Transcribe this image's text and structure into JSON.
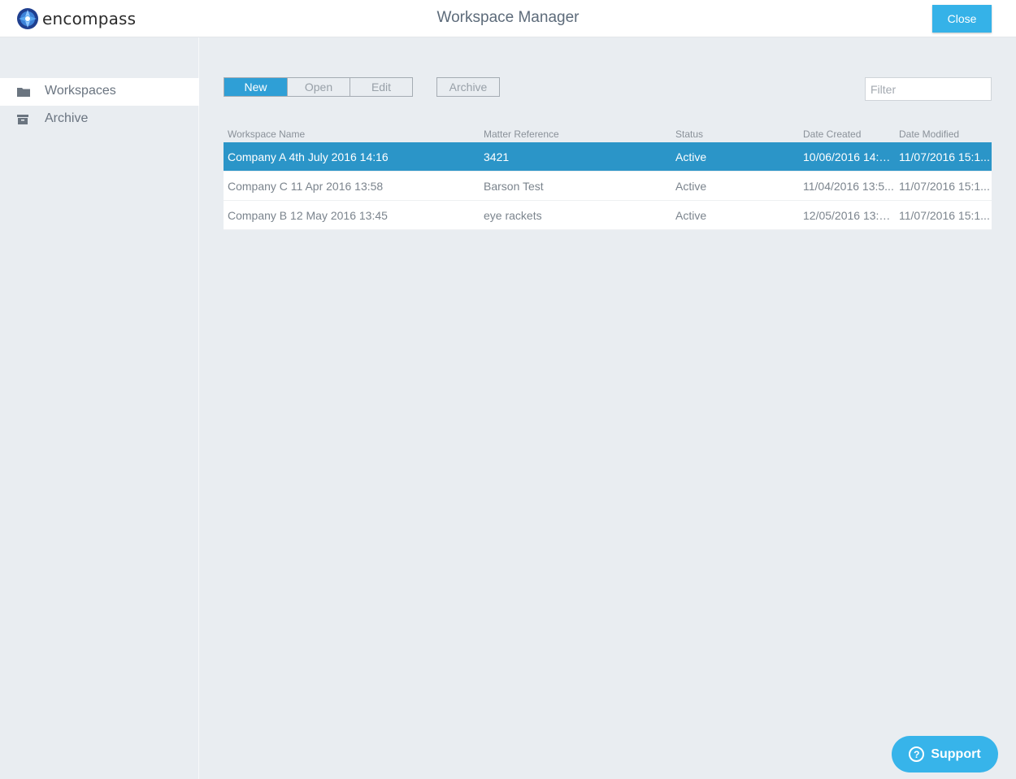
{
  "header": {
    "logo_text": "encompass",
    "title": "Workspace Manager",
    "close_label": "Close"
  },
  "sidebar": {
    "items": [
      {
        "label": "Workspaces",
        "icon": "folder-icon",
        "active": true
      },
      {
        "label": "Archive",
        "icon": "archive-box-icon",
        "active": false
      }
    ]
  },
  "toolbar": {
    "new_label": "New",
    "open_label": "Open",
    "edit_label": "Edit",
    "archive_label": "Archive",
    "filter_placeholder": "Filter"
  },
  "table": {
    "columns": [
      "Workspace Name",
      "Matter Reference",
      "Status",
      "Date Created",
      "Date Modified"
    ],
    "rows": [
      {
        "name": "Company A 4th July 2016 14:16",
        "matter": "3421",
        "status": "Active",
        "created": "10/06/2016 14:1...",
        "modified": "11/07/2016 15:1...",
        "selected": true
      },
      {
        "name": "Company C 11 Apr 2016 13:58",
        "matter": "Barson Test",
        "status": "Active",
        "created": "11/04/2016 13:5...",
        "modified": "11/07/2016 15:1...",
        "selected": false
      },
      {
        "name": "Company B 12 May 2016 13:45",
        "matter": "eye rackets",
        "status": "Active",
        "created": "12/05/2016 13:4...",
        "modified": "11/07/2016 15:1...",
        "selected": false
      }
    ]
  },
  "support": {
    "label": "Support",
    "icon": "question-circle-icon"
  },
  "colors": {
    "accent": "#35b2e8",
    "selected_row": "#2b95c8",
    "background": "#e9edf1"
  }
}
